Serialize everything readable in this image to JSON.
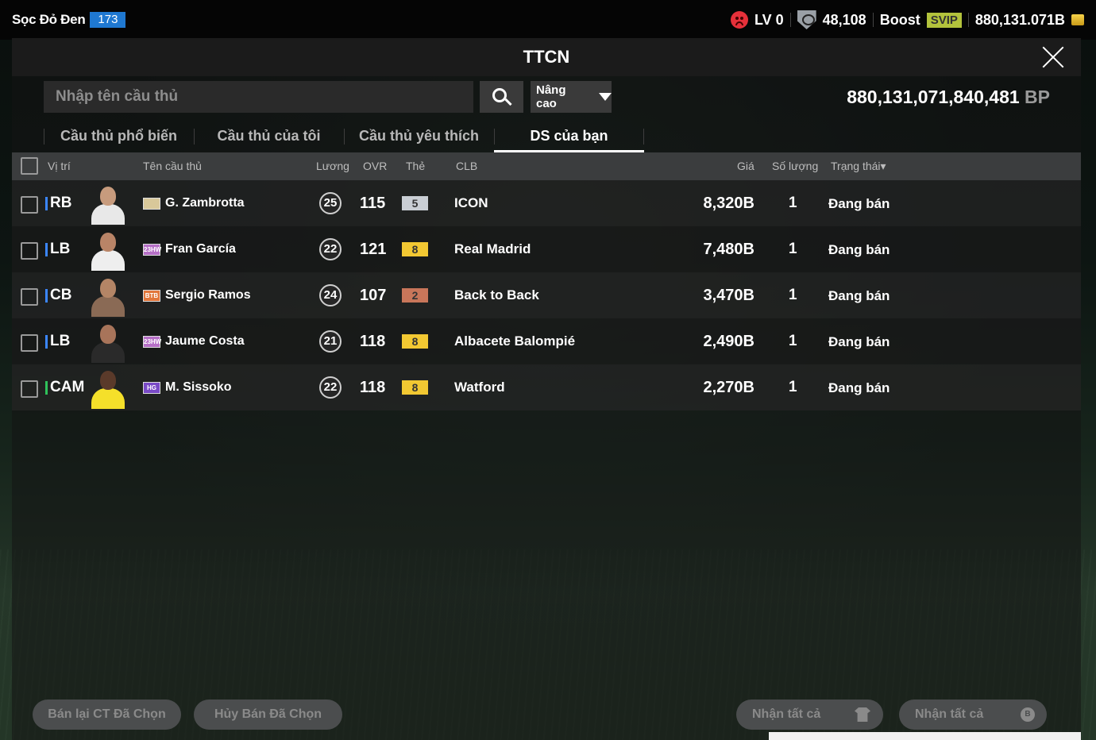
{
  "topbar": {
    "team_name": "Sọc Đỏ Đen",
    "team_level": "173",
    "level": "LV 0",
    "trophies": "48,108",
    "boost": "Boost",
    "vip": "SVIP",
    "coins": "880,131.071B"
  },
  "header": {
    "title": "TTCN"
  },
  "search": {
    "placeholder": "Nhập tên cầu thủ",
    "advanced_label": "Nâng cao",
    "bp_value": "880,131,071,840,481",
    "bp_unit": "BP"
  },
  "tabs": [
    {
      "label": "Cầu thủ phổ biến"
    },
    {
      "label": "Cầu thủ của tôi"
    },
    {
      "label": "Cầu thủ yêu thích"
    },
    {
      "label": "DS của bạn"
    }
  ],
  "columns": {
    "position": "Vị trí",
    "name": "Tên cầu thủ",
    "wage": "Lương",
    "ovr": "OVR",
    "card": "Thẻ",
    "club": "CLB",
    "price": "Giá",
    "qty": "Số lượng",
    "status": "Trạng thái▾"
  },
  "rows": [
    {
      "pos": "RB",
      "season": "",
      "name": "G. Zambrotta",
      "wage": "25",
      "ovr": "115",
      "grade": "5",
      "grade_color": "#c9ced4",
      "grade_text": "#333333",
      "club": "ICON",
      "price": "8,320B",
      "qty": "1",
      "status": "Đang bán",
      "pos_color": "#3b86ff"
    },
    {
      "pos": "LB",
      "season": "23HW",
      "name": "Fran García",
      "wage": "22",
      "ovr": "121",
      "grade": "8",
      "grade_color": "#f2c832",
      "grade_text": "#333333",
      "club": "Real Madrid",
      "price": "7,480B",
      "qty": "1",
      "status": "Đang bán",
      "pos_color": "#3b86ff"
    },
    {
      "pos": "CB",
      "season": "BTB",
      "name": "Sergio Ramos",
      "wage": "24",
      "ovr": "107",
      "grade": "2",
      "grade_color": "#c8765a",
      "grade_text": "#333333",
      "club": "Back to Back",
      "price": "3,470B",
      "qty": "1",
      "status": "Đang bán",
      "pos_color": "#3b86ff"
    },
    {
      "pos": "LB",
      "season": "23HW",
      "name": "Jaume Costa",
      "wage": "21",
      "ovr": "118",
      "grade": "8",
      "grade_color": "#f2c832",
      "grade_text": "#333333",
      "club": "Albacete Balompié",
      "price": "2,490B",
      "qty": "1",
      "status": "Đang bán",
      "pos_color": "#3b86ff"
    },
    {
      "pos": "CAM",
      "season": "HG",
      "name": "M. Sissoko",
      "wage": "22",
      "ovr": "118",
      "grade": "8",
      "grade_color": "#f2c832",
      "grade_text": "#333333",
      "club": "Watford",
      "price": "2,270B",
      "qty": "1",
      "status": "Đang bán",
      "pos_color": "#2fc25a"
    }
  ],
  "bottom": {
    "resell_label": "Bán lại CT Đã Chọn",
    "cancel_label": "Hủy Bán Đã Chọn",
    "claim_all_label": "Nhận tất cả",
    "claim_all_label_2": "Nhận tất cả",
    "coin_glyph": "B"
  }
}
